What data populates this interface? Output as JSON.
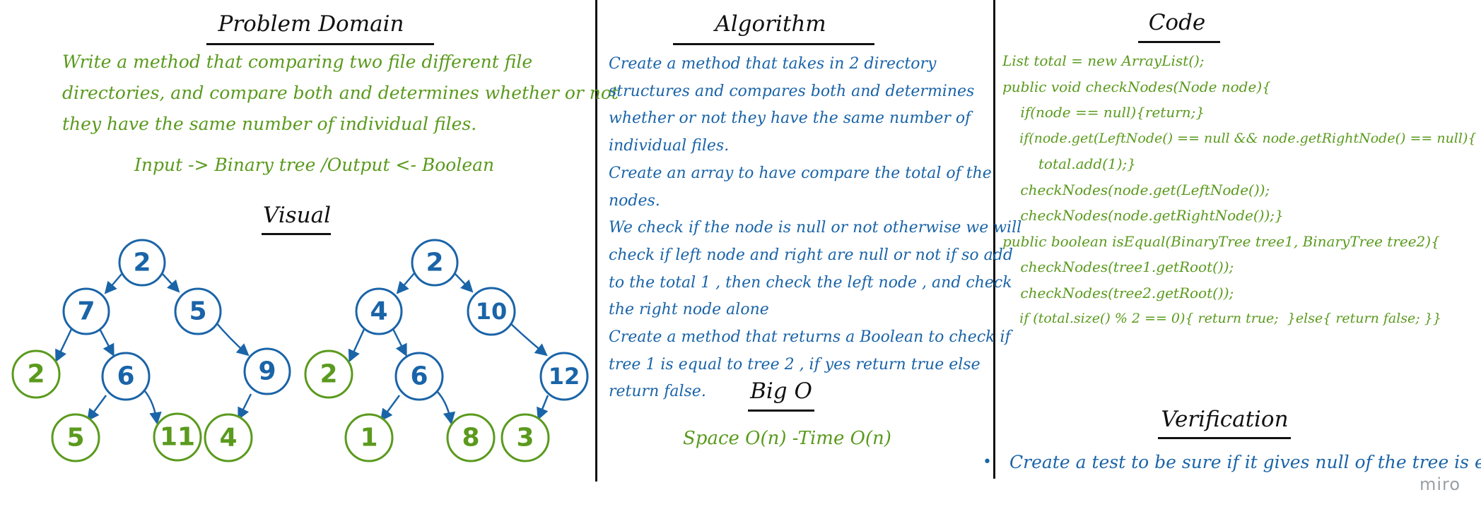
{
  "problem_domain": {
    "title": "Problem Domain",
    "lines": [
      "Write a method that comparing two file different file",
      "directories, and compare both and determines whether or not",
      "they have the same number of individual files."
    ],
    "io": "Input -> Binary tree /Output <- Boolean"
  },
  "visual": {
    "title": "Visual",
    "tree1": [
      "2",
      "7",
      "5",
      "2",
      "6",
      "9",
      "5",
      "11",
      "4"
    ],
    "tree2": [
      "2",
      "4",
      "10",
      "2",
      "6",
      "12",
      "1",
      "8",
      "3"
    ]
  },
  "algorithm": {
    "title": "Algorithm",
    "lines": [
      "Create a method that takes in 2 directory",
      "structures and compares both and determines",
      "whether or not they have the same number of",
      "individual files.",
      "Create an array to have compare the total of the",
      "nodes.",
      "We check if the node is null or not otherwise we will",
      "check if left node and right are null or not if so add",
      "to the total 1 , then check the left node , and check",
      "the right node alone",
      "Create a method that returns a Boolean to check if",
      "tree 1 is equal to tree 2  , if yes return true else",
      "return false."
    ]
  },
  "big_o": {
    "title": "Big O",
    "text": "Space O(n) -Time O(n)"
  },
  "code": {
    "title": "Code",
    "lines": [
      "List total = new ArrayList();",
      "",
      "public void checkNodes(Node node){",
      "    if(node == null){return;}",
      "    if(node.get(LeftNode() == null && node.getRightNode() == null){",
      "        total.add(1);}",
      "    checkNodes(node.get(LeftNode());",
      "    checkNodes(node.getRightNode());}",
      "",
      "public boolean isEqual(BinaryTree tree1, BinaryTree tree2){",
      "    checkNodes(tree1.getRoot());",
      "    checkNodes(tree2.getRoot());",
      "    if (total.size() % 2 == 0){ return true;  }else{ return false; }}"
    ]
  },
  "verification": {
    "title": "Verification",
    "bullet": "Create a test to be sure if it gives null of the tree is empty"
  },
  "watermark": "miro",
  "colors": {
    "green": "#5a9a1d",
    "blue": "#1a64a8",
    "ink": "#111111"
  }
}
